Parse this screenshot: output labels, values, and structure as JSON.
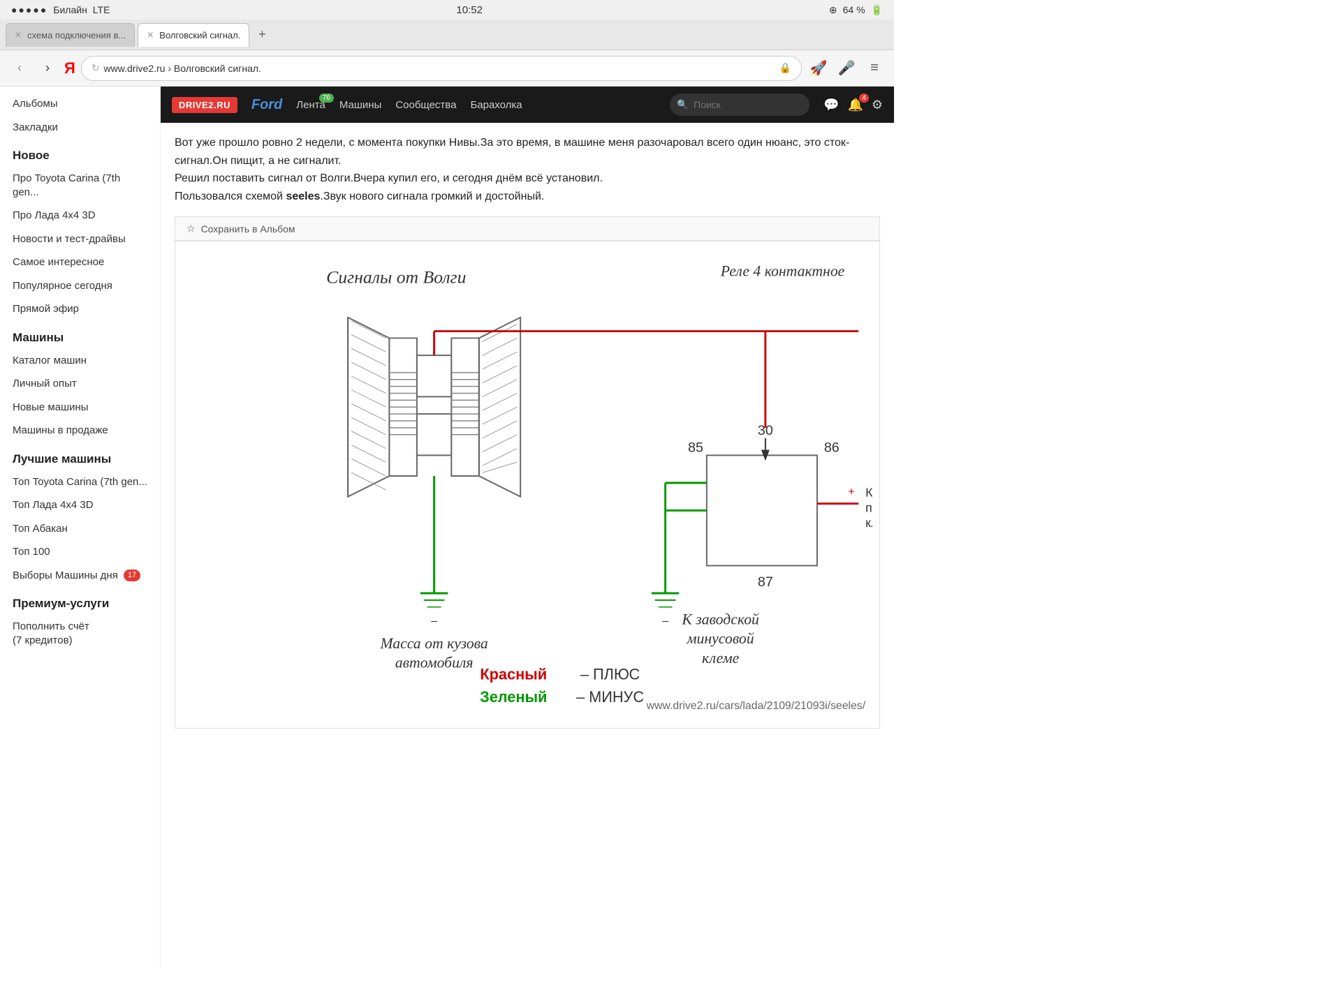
{
  "status_bar": {
    "carrier": "Билайн",
    "network": "LTE",
    "time": "10:52",
    "battery": "64 %",
    "location_icon": "⊕"
  },
  "tabs": [
    {
      "id": "tab1",
      "label": "схема подключения в...",
      "active": false
    },
    {
      "id": "tab2",
      "label": "Волговский сигнал.",
      "active": true
    }
  ],
  "tab_add_label": "+",
  "nav": {
    "back_label": "‹",
    "forward_label": "›",
    "yandex_label": "Я",
    "address": "www.drive2.ru",
    "breadcrumb": "Волговский сигнал.",
    "address_display": "www.drive2.ru › Волговский сигнал.",
    "microphone_label": "mic",
    "menu_label": "≡"
  },
  "drive2_header": {
    "logo": "DRIVE2.RU",
    "ford_logo": "Ford",
    "nav_items": [
      {
        "label": "Лента",
        "badge": "76"
      },
      {
        "label": "Машины",
        "badge": null
      },
      {
        "label": "Сообщества",
        "badge": null
      },
      {
        "label": "Барахолка",
        "badge": null
      }
    ],
    "search_placeholder": "Поиск",
    "notifications_badge": "4"
  },
  "sidebar": {
    "items_top": [
      {
        "label": "Альбомы"
      },
      {
        "label": "Закладки"
      }
    ],
    "sections": [
      {
        "title": "Новое",
        "items": [
          {
            "label": "Про Toyota Carina (7th gen..."
          },
          {
            "label": "Про Лада 4x4 3D"
          },
          {
            "label": "Новости и тест-драйвы"
          },
          {
            "label": "Самое интересное"
          },
          {
            "label": "Популярное сегодня"
          },
          {
            "label": "Прямой эфир"
          }
        ]
      },
      {
        "title": "Машины",
        "items": [
          {
            "label": "Каталог машин"
          },
          {
            "label": "Личный опыт"
          },
          {
            "label": "Новые машины"
          },
          {
            "label": "Машины в продаже"
          }
        ]
      },
      {
        "title": "Лучшие машины",
        "items": [
          {
            "label": "Топ Toyota Carina (7th gen..."
          },
          {
            "label": "Топ Лада 4x4 3D"
          },
          {
            "label": "Топ Абакан"
          },
          {
            "label": "Топ 100"
          },
          {
            "label": "Выборы Машины дня",
            "badge": "17"
          }
        ]
      },
      {
        "title": "Премиум-услуги",
        "items": [
          {
            "label": "Пополнить счёт\n(7 кредитов)"
          }
        ]
      }
    ]
  },
  "article": {
    "text": "Вот уже прошло ровно 2 недели, с момента покупки Нивы.За это время, в машине меня разочаровал всего один нюанс, это сток-сигнал.Он пищит, а не сигналит.\nРешил поставить сигнал от Волги.Вчера купил его, и сегодня днём всё установил.\nПользовался схемой seeles.Звук нового сигнала громкий и достойный.",
    "bold_word": "seeles",
    "save_to_album": "Сохранить в Альбом",
    "diagram_labels": {
      "signals": "Сигналы от Волги",
      "relay": "Реле 4 контактное",
      "pin_30": "30",
      "pin_85": "85",
      "pin_86": "86",
      "pin_87": "87",
      "mass": "Масса от кузова\nавтомобиля",
      "plus_terminal": "К заводской\nплюсовой\nклеме",
      "minus_terminal": "К заводской\nминусовой\nклеме",
      "red_label": "Красный – ПЛЮС",
      "green_label": "Зеленый – МИНУС",
      "watermark": "www.drive2.ru/cars/lada/2109/21093i/seeles/"
    }
  }
}
